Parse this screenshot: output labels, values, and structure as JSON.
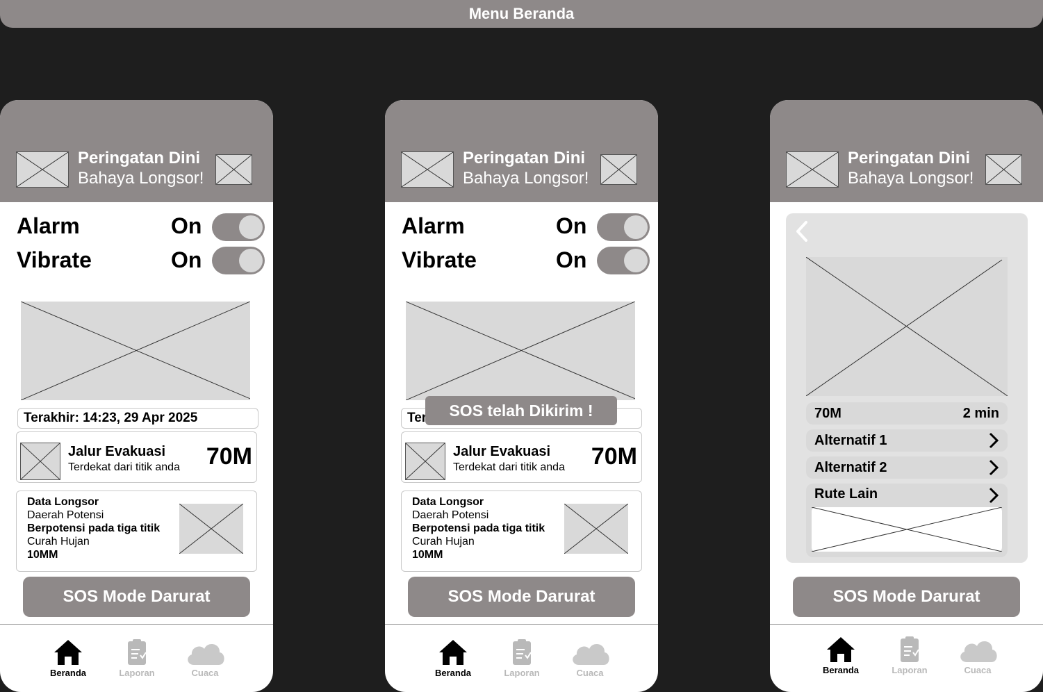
{
  "page_title": "Menu Beranda",
  "header": {
    "title_line1": "Peringatan Dini",
    "title_line2": "Bahaya Longsor!"
  },
  "settings": {
    "alarm_label": "Alarm",
    "alarm_value": "On",
    "vibrate_label": "Vibrate",
    "vibrate_value": "On"
  },
  "last_update": "Terakhir: 14:23, 29 Apr 2025",
  "last_update_partial": "Ter",
  "evacuation": {
    "title": "Jalur Evakuasi",
    "subtitle": "Terdekat dari titik anda",
    "distance": "70M"
  },
  "landslide_data": {
    "heading": "Data Longsor",
    "area_label": "Daerah Potensi",
    "area_value": "Berpotensi pada tiga titik",
    "rain_label": "Curah Hujan",
    "rain_value": "10MM"
  },
  "sos_button": "SOS Mode Darurat",
  "sos_toast": "SOS telah Dikirim !",
  "route_detail": {
    "distance": "70M",
    "time": "2 min",
    "options": [
      "Alternatif 1",
      "Alternatif 2",
      "Rute Lain"
    ]
  },
  "nav": {
    "home": "Beranda",
    "report": "Laporan",
    "weather": "Cuaca"
  },
  "colors": {
    "accent_gray": "#8e8989",
    "placeholder": "#d9d9d9",
    "background": "#1e1e1e"
  }
}
